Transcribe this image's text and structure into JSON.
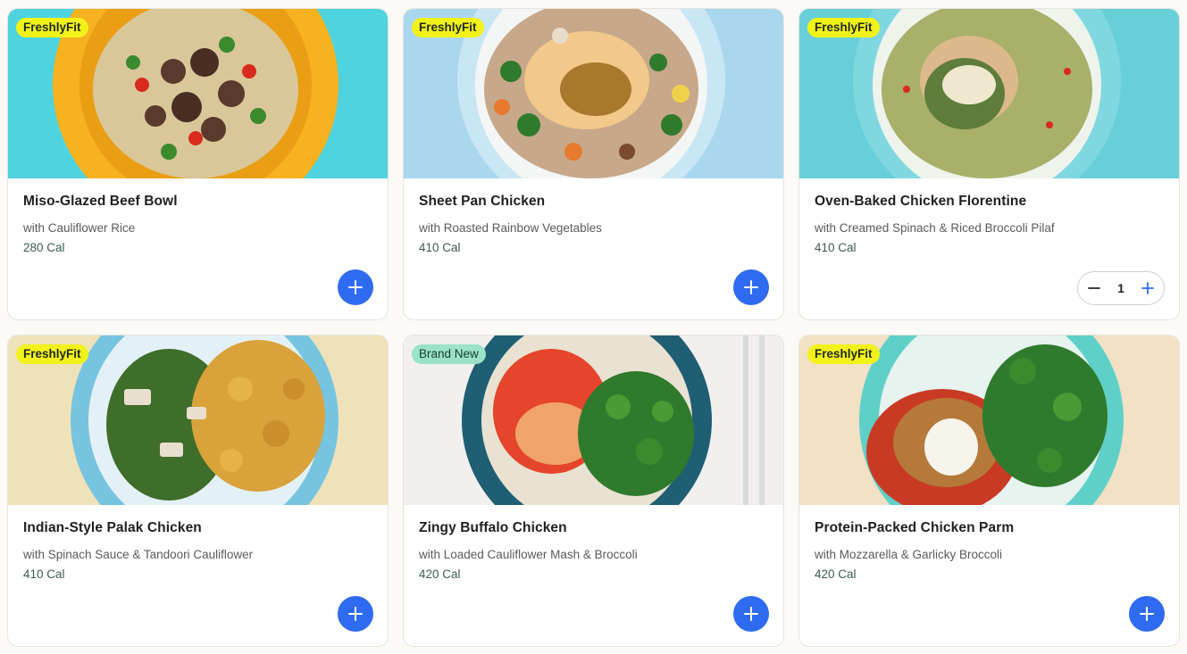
{
  "colors": {
    "accent": "#2e6bf0",
    "badge_fit": "#f2f21a",
    "badge_new": "#9be3c6"
  },
  "icons": {
    "add": "plus-icon",
    "minus": "minus-icon"
  },
  "meals": [
    {
      "badge": "FreshlyFit",
      "title": "Miso-Glazed Beef Bowl",
      "subtitle": "with Cauliflower Rice",
      "calories": "280 Cal"
    },
    {
      "badge": "FreshlyFit",
      "title": "Sheet Pan Chicken",
      "subtitle": "with Roasted Rainbow Vegetables",
      "calories": "410 Cal"
    },
    {
      "badge": "FreshlyFit",
      "title": "Oven-Baked Chicken Florentine",
      "subtitle": "with Creamed Spinach & Riced Broccoli Pilaf",
      "calories": "410 Cal",
      "quantity": "1"
    },
    {
      "badge": "FreshlyFit",
      "title": "Indian-Style Palak Chicken",
      "subtitle": "with Spinach Sauce & Tandoori Cauliflower",
      "calories": "410 Cal"
    },
    {
      "badge": "Brand New",
      "title": "Zingy Buffalo Chicken",
      "subtitle": "with Loaded Cauliflower Mash & Broccoli",
      "calories": "420 Cal"
    },
    {
      "badge": "FreshlyFit",
      "title": "Protein-Packed Chicken Parm",
      "subtitle": "with Mozzarella & Garlicky Broccoli",
      "calories": "420 Cal"
    }
  ]
}
